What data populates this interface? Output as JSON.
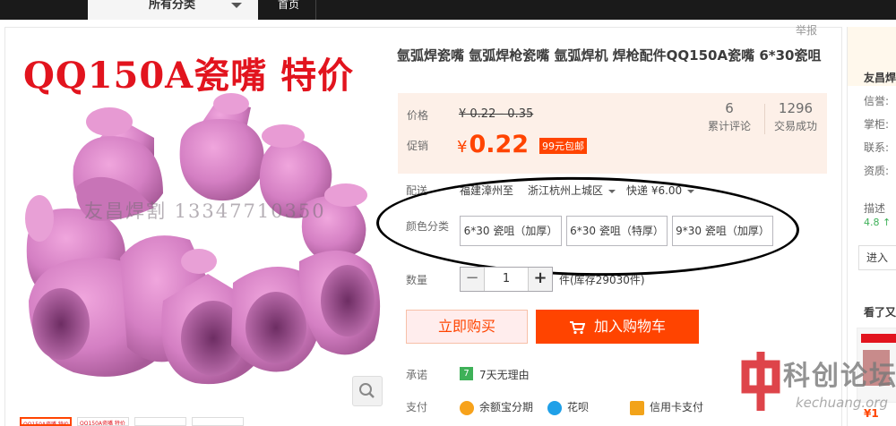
{
  "nav": {
    "category": "所有分类",
    "home": "首页"
  },
  "report": "举报",
  "gallery": {
    "banner": "QQ150A瓷嘴 特价",
    "watermark": "友昌焊割 13347710350",
    "thumbnail_caption": "QQ150A瓷嘴 特价"
  },
  "product": {
    "title": "氩弧焊瓷嘴 氩弧焊枪瓷嘴 氩弧焊机 焊枪配件QQ150A瓷嘴 6*30瓷咀",
    "price_label": "价格",
    "original_price": "¥ 0.22 - 0.35",
    "promo_label": "促销",
    "currency": "¥",
    "sale_price": "0.22",
    "shipping_badge": "99元包邮",
    "reviews_count": "6",
    "reviews_label": "累计评论",
    "sales_count": "1296",
    "sales_label": "交易成功",
    "delivery_label": "配送",
    "delivery_from": "福建漳州至",
    "delivery_to": "浙江杭州上城区",
    "delivery_method": "快递 ¥6.00",
    "sku_label": "颜色分类",
    "sku_options": [
      "6*30 瓷咀（加厚）",
      "6*30 瓷咀（特厚）",
      "9*30 瓷咀（加厚）"
    ],
    "quantity_label": "数量",
    "quantity": "1",
    "stock_text": "件(库存29030件)",
    "buy_now": "立即购买",
    "add_to_cart": "加入购物车",
    "promise_label": "承诺",
    "promise_icon_text": "7",
    "promise_text": "7天无理由",
    "payment_label": "支付",
    "payments": [
      "余额宝分期",
      "花呗",
      "信用卡支付"
    ]
  },
  "shop": {
    "name": "友昌焊",
    "credit_label": "信誉:",
    "seller_label": "掌柜:",
    "contact_label": "联系:",
    "qualification_label": "资质:",
    "rating_label": "描述",
    "rating_value": "4.8 ↑",
    "enter_button": "进入",
    "also_viewed": "看了又",
    "rec_price": "¥1"
  },
  "forum_watermark": {
    "cn": "科创论坛",
    "en": "kechuang.org"
  },
  "colors": {
    "accent": "#ff4400",
    "price_bg": "#fdf0e8",
    "nav_bg": "#1a1a1a"
  }
}
